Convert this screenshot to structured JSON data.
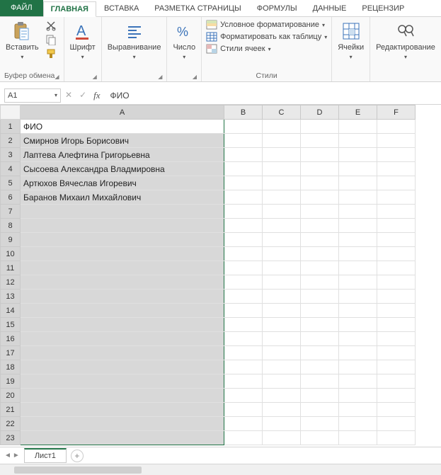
{
  "tabs": {
    "file": "ФАЙЛ",
    "items": [
      "ГЛАВНАЯ",
      "ВСТАВКА",
      "РАЗМЕТКА СТРАНИЦЫ",
      "ФОРМУЛЫ",
      "ДАННЫЕ",
      "РЕЦЕНЗИР"
    ],
    "active": 0
  },
  "ribbon": {
    "clipboard": {
      "paste": "Вставить",
      "label": "Буфер обмена"
    },
    "font": {
      "btn": "Шрифт"
    },
    "align": {
      "btn": "Выравнивание"
    },
    "number": {
      "btn": "Число"
    },
    "styles": {
      "cond": "Условное форматирование",
      "table": "Форматировать как таблицу",
      "cellstyles": "Стили ячеек",
      "label": "Стили"
    },
    "cells": {
      "btn": "Ячейки"
    },
    "editing": {
      "btn": "Редактирование"
    }
  },
  "namebox": "A1",
  "formula_value": "ФИО",
  "columns": [
    "A",
    "B",
    "C",
    "D",
    "E",
    "F"
  ],
  "rows": [
    "ФИО",
    "Смирнов Игорь Борисович",
    "Лаптева Алефтина Григорьевна",
    "Сысоева Александра Владмировна",
    "Артюхов Вячеслав Игоревич",
    "Баранов Михаил Михайлович",
    "",
    "",
    "",
    "",
    "",
    "",
    "",
    "",
    "",
    "",
    "",
    "",
    "",
    "",
    "",
    "",
    ""
  ],
  "selected_col": "A",
  "active_cell_row": 1,
  "sheet": {
    "name": "Лист1"
  }
}
